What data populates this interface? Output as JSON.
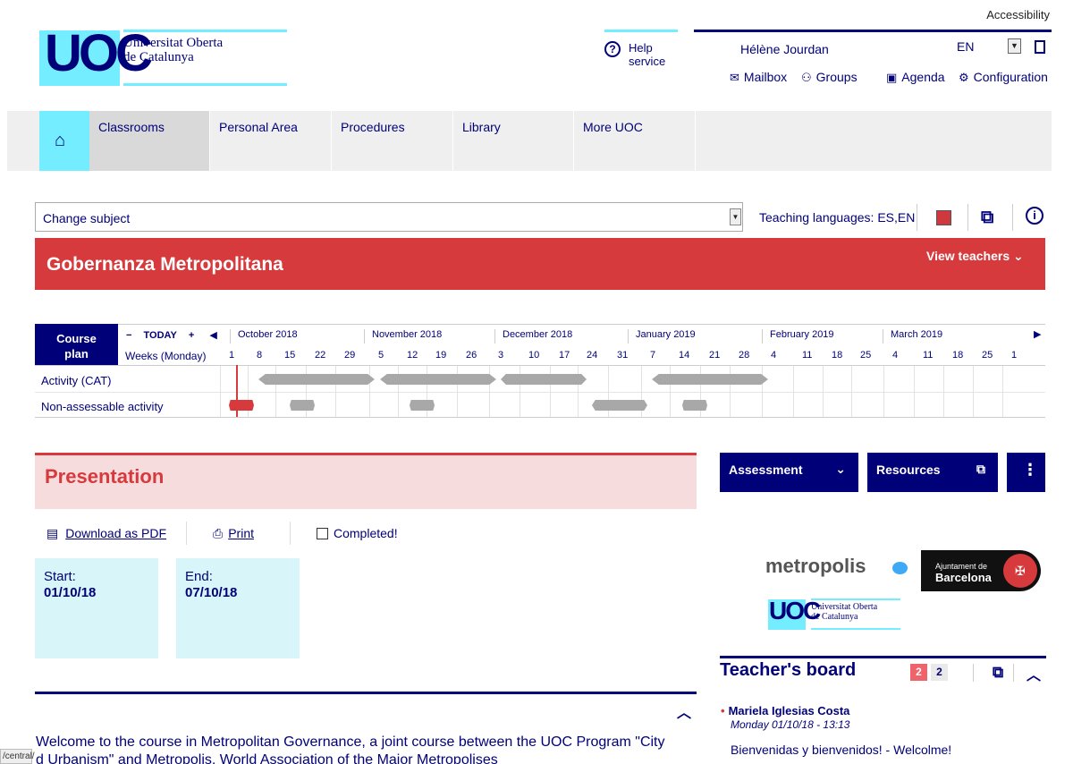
{
  "header": {
    "accessibility": "Accessibility",
    "logo_text": "UOC",
    "uni_line1": "Universitat Oberta",
    "uni_line2": "de Catalunya",
    "help_line1": "Help",
    "help_line2": "service",
    "user_name": "Hélène Jourdan",
    "language": "EN",
    "menu": [
      {
        "icon": "mail-icon",
        "label": "Mailbox"
      },
      {
        "icon": "groups-icon",
        "label": "Groups"
      },
      {
        "icon": "calendar-icon",
        "label": "Agenda"
      },
      {
        "icon": "gear-icon",
        "label": "Configuration"
      }
    ]
  },
  "nav": {
    "items": [
      "Classrooms",
      "Personal Area",
      "Procedures",
      "Library",
      "More UOC"
    ],
    "active": "Classrooms"
  },
  "subject": {
    "select_value": "Change subject",
    "teaching_languages": "Teaching languages: ES,EN",
    "course_title": "Gobernanza Metropolitana",
    "view_teachers": "View teachers"
  },
  "timeline": {
    "course_plan_line1": "Course",
    "course_plan_line2": "plan",
    "today": "TODAY",
    "minus": "−",
    "plus": "+",
    "weeks_label": "Weeks (Monday)",
    "months": [
      "October 2018",
      "November 2018",
      "December 2018",
      "January 2019",
      "February 2019",
      "March 2019"
    ],
    "days": [
      "1",
      "8",
      "15",
      "22",
      "29",
      "5",
      "12",
      "19",
      "26",
      "3",
      "10",
      "17",
      "24",
      "31",
      "7",
      "14",
      "21",
      "28",
      "4",
      "11",
      "18",
      "25",
      "4",
      "11",
      "18",
      "25",
      "1"
    ],
    "rows": [
      "Activity (CAT)",
      "Non-assessable activity"
    ]
  },
  "presentation": {
    "title": "Presentation",
    "download_pdf": "Download as PDF",
    "print": "Print",
    "completed": "Completed!",
    "start_label": "Start:",
    "start_date": "01/10/18",
    "end_label": "End:",
    "end_date": "07/10/18",
    "welcome_line1": "Welcome  to the course in Metropolitan Governance, a joint course between the UOC Program \"City",
    "welcome_line2": "d Urbanism\" and Metropolis, World Association of the Major Metropolises"
  },
  "status_url": "/central/",
  "right": {
    "assessment": "Assessment",
    "resources": "Resources",
    "more": "⋮",
    "metropolis": "metropolis",
    "bcn_line1": "Ajuntament de",
    "bcn_line2": "Barcelona",
    "uoc_small": "UOC",
    "uoc_small_line1": "Universitat Oberta",
    "uoc_small_line2": "de Catalunya",
    "board_title": "Teacher's board",
    "badge_new": "2",
    "badge_total": "2",
    "msg_author": "Mariela Iglesias Costa",
    "msg_date": "Monday 01/10/18 - 13:13",
    "msg_text": "Bienvenidas y bienvenidos! - Welcolme!"
  },
  "colors": {
    "navy": "#000078",
    "cyan": "#73edff",
    "red": "#d73a3c",
    "pink": "#f7dcdd"
  }
}
